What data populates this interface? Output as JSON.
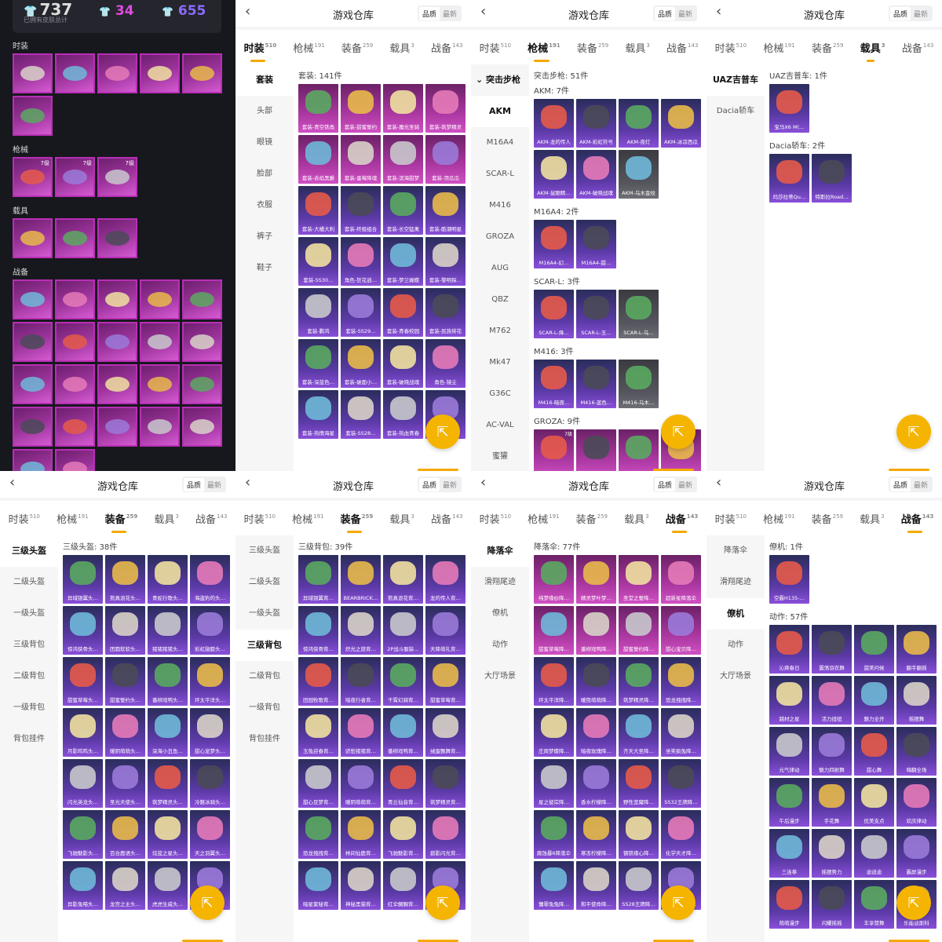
{
  "summary": {
    "total": "737",
    "total_caption": "已拥有皮肤总计",
    "count_a": "34",
    "count_b": "655",
    "sections": [
      {
        "label": "时装",
        "count": 6
      },
      {
        "label": "枪械",
        "count": 3,
        "levels": [
          "7级",
          "7级",
          "7级"
        ]
      },
      {
        "label": "载具",
        "count": 3
      },
      {
        "label": "战备",
        "count": 22
      }
    ]
  },
  "app": {
    "title": "游戏仓库",
    "sort_quality": "品质",
    "sort_latest": "最新",
    "fab_icon": "share-icon",
    "tabs": [
      {
        "label": "时装",
        "count": "510"
      },
      {
        "label": "枪械",
        "count": "191"
      },
      {
        "label": "装备",
        "count": "259"
      },
      {
        "label": "载具",
        "count": "3"
      },
      {
        "label": "战备",
        "count": "143"
      }
    ]
  },
  "p1": {
    "sidebar": [
      "套装",
      "头部",
      "眼镜",
      "脸部",
      "衣服",
      "裤子",
      "鞋子"
    ],
    "group": "套装: 141件",
    "items": [
      "套装-青空铁甬",
      "套装-甜蜜誓约",
      "套装-魔光圣骑",
      "套装-筑梦精灵",
      "套装-赤焰黑爵",
      "套装-蛋莓降魂",
      "套装-滨海甜梦",
      "套装-顶瓜瓜",
      "套装-大橘大利",
      "套装-终极组合",
      "套装-长空猛禽",
      "套装-酷潮明星",
      "套装-SS30…",
      "角色-狂花逍…",
      "套装-梦兰蝴蝶",
      "套装-黎明探…",
      "套装-鹏鸿",
      "套装-SS29…",
      "套装-青春校园",
      "套装-民族绯花",
      "套装-深蓝色…",
      "套装-破面小…",
      "套装-破晓战魂",
      "角色-镜尘",
      "套装-热情海星",
      "套装-SS28…",
      "套装-热血青春",
      "套装-…"
    ]
  },
  "p2": {
    "sidebar_header": "突击步枪",
    "sidebar": [
      "AKM",
      "M16A4",
      "SCAR-L",
      "M416",
      "GROZA",
      "AUG",
      "QBZ",
      "M762",
      "Mk47",
      "G36C",
      "AC-VAL",
      "蜜獾"
    ],
    "group": "突击步枪: 51件",
    "sub": [
      {
        "label": "AKM: 7件",
        "items": [
          "AKM-龙的传人",
          "AKM-彩虹符号",
          "AKM-夜灯",
          "AKM-冰凉西瓜",
          "AKM-鼠眼睛…",
          "AKM-破晓战魂",
          "AKM-乌木金纹"
        ]
      },
      {
        "label": "M16A4: 2件",
        "items": [
          "M16A4-幻…",
          "M16A4-甜…"
        ]
      },
      {
        "label": "SCAR-L: 3件",
        "items": [
          "SCAR-L-烽…",
          "SCAR-L-玉…",
          "SCAR-L-乌…"
        ]
      },
      {
        "label": "M416: 3件",
        "items": [
          "M416-暗夜…",
          "M416-蓝色…",
          "M416-乌木…"
        ]
      },
      {
        "label": "GROZA: 9件",
        "items": [
          "",
          "",
          "",
          ""
        ],
        "levels": [
          "7级"
        ]
      }
    ]
  },
  "p3": {
    "sidebar": [
      "UAZ吉普车",
      "Dacia轿车"
    ],
    "sub": [
      {
        "label": "UAZ吉普车: 1件",
        "items": [
          "宝马X6 M(…"
        ]
      },
      {
        "label": "Dacia轿车: 2件",
        "items": [
          "玛莎拉蒂Qu…",
          "特斯拉Road…"
        ]
      }
    ]
  },
  "p4": {
    "sidebar": [
      "三级头盔",
      "二级头盔",
      "一级头盔",
      "三级背包",
      "二级背包",
      "一级背包",
      "背包挂件"
    ],
    "group": "三级头盔: 38件",
    "items": [
      "异域银翼头…",
      "熊真浪花头…",
      "青蛇行歌头…",
      "海盗豹的头…",
      "惊鸿侠骨头…",
      "团圆软软头…",
      "猪猪猪猪头…",
      "彩虹翅膀头…",
      "甜蜜草莓头…",
      "甜蜜誓约头…",
      "番柳戏鸭头…",
      "环太平洋头…",
      "月影鸣鸣头…",
      "暖阴萌萌头…",
      "深海小丑鱼…",
      "甜心宠梦头…",
      "闪光英龙头…",
      "圣光天使头…",
      "筑梦精灵头…",
      "冷魅冰骑头…",
      "飞驰魅影头…",
      "百合鹿语头…",
      "炫蓝之星头…",
      "天之羽翼头…",
      "异影兔喵头…",
      "龙宫之主头…",
      "虎虎生威头…",
      ""
    ]
  },
  "p5": {
    "sidebar": [
      "三级头盔",
      "二级头盔",
      "一级头盔",
      "三级背包",
      "二级背包",
      "一级背包",
      "背包挂件"
    ],
    "group": "三级背包: 39件",
    "items": [
      "异域银翼背…",
      "BEARBRICK…",
      "熊真浪花背…",
      "龙的传人背…",
      "惊鸿侠骨背…",
      "炽光之旅背…",
      "2P战斗服装…",
      "天降萌礼背…",
      "田园牧歌背…",
      "暗夜行者背…",
      "干霄幻骑背…",
      "甜蜜草莓背…",
      "玉兔迎春背…",
      "骄愁猪猪背…",
      "番柳戏鸭背…",
      "绒蛋飘舞背…",
      "甜心豆梦背…",
      "暖阴萌萌背…",
      "青丘仙音背…",
      "筑梦精灵背…",
      "恐龙拽拽背…",
      "林间仙鹿背…",
      "飞驰魅影背…",
      "碧影闪光背…",
      "暗星紫秘背…",
      "神秘黑猫背…",
      "红伞鲷鲷背…",
      ""
    ]
  },
  "p6": {
    "sidebar": [
      "降落伞",
      "滑翔尾迹",
      "僚机",
      "动作",
      "大厅场景"
    ],
    "group": "降落伞: 77件",
    "items": [
      "纯梦缘纱降…",
      "精灵梦叶梦…",
      "圣堂之誓降…",
      "超新星降落伞",
      "甜蜜草莓降…",
      "番柳戏鸭降…",
      "甜蜜誓约降…",
      "甜心宝贝降…",
      "环太平洋降…",
      "暖熊萌萌降…",
      "筑梦精灵降…",
      "恐龙拽拽降…",
      "庄周梦蝶降…",
      "暗夜玫瑰降…",
      "齐天大圣降…",
      "坐笑疯兔降…",
      "星之彼岸降…",
      "香水柠檬降…",
      "野性宽窿降…",
      "SS32王牌降…",
      "腐蚀暴6降落伞",
      "寒冻柠檬降…",
      "钢铁缘心降…",
      "化学天才降…",
      "慵罪兔兔降…",
      "和平使命降…",
      "SS28王牌降…",
      "玫瑰绽放降…"
    ]
  },
  "p7": {
    "sidebar": [
      "降落伞",
      "滑翔尾迹",
      "僚机",
      "动作",
      "大厅场景"
    ],
    "sub": [
      {
        "label": "僚机: 1件",
        "items": [
          "空霸H135-…"
        ]
      },
      {
        "label": "动作: 57件",
        "items": [
          "沁爽春日",
          "震荡羽衣舞",
          "甜美问候",
          "翻手翻摇",
          "跳材之星",
          "活力扭扭",
          "魅力全开",
          "摇摆舞",
          "元气律动",
          "魅力四射舞",
          "甜心舞",
          "嗨翻全场",
          "午后漫步",
          "手花舞",
          "优美支点",
          "欢庆律动",
          "三连拳",
          "摇摆势力",
          "迪迪迪",
          "霸屏漫步",
          "萌萌漫步",
          "闪耀摇摇",
          "丰享赞舞",
          "乐能迪斯科"
        ]
      }
    ]
  }
}
